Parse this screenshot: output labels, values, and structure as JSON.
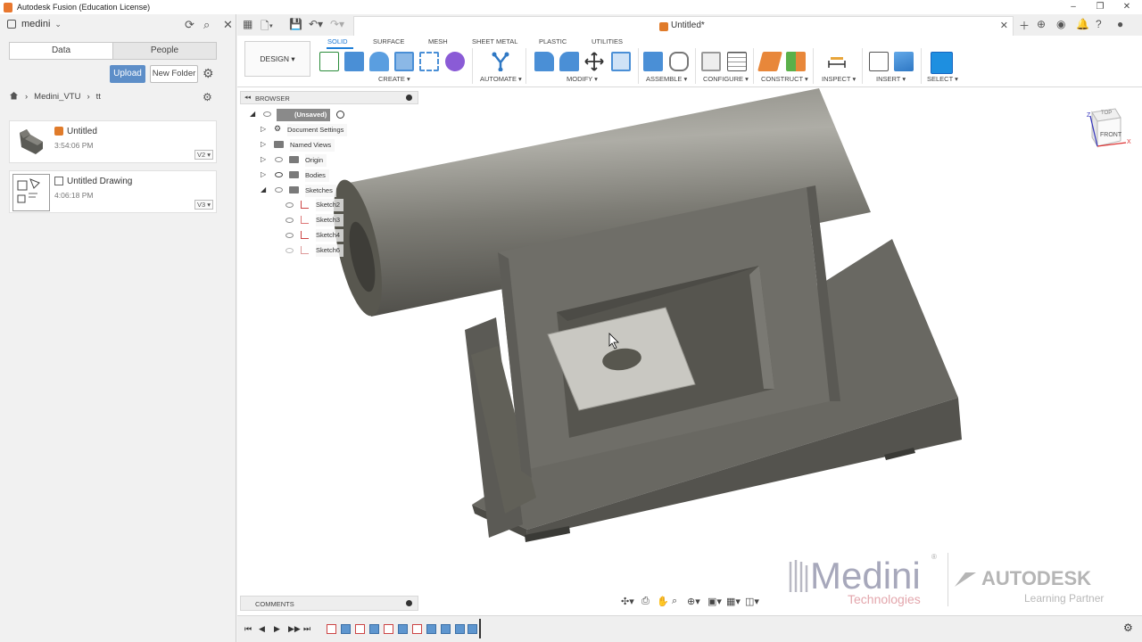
{
  "window": {
    "title": "Autodesk Fusion (Education License)",
    "controls": [
      "–",
      "❐",
      "✕"
    ]
  },
  "data_panel": {
    "hub_name": "medini",
    "tabs": [
      "Data",
      "People"
    ],
    "upload_label": "Upload",
    "new_folder_label": "New Folder",
    "breadcrumb": [
      "Medini_VTU",
      "tt"
    ],
    "files": [
      {
        "name": "Untitled",
        "time": "3:54:06 PM",
        "version": "V2 ▾"
      },
      {
        "name": "Untitled Drawing",
        "time": "4:06:18 PM",
        "version": "V3 ▾"
      }
    ]
  },
  "document": {
    "name": "Untitled*"
  },
  "ribbon": {
    "workspace": "DESIGN ▾",
    "tabs": [
      "SOLID",
      "SURFACE",
      "MESH",
      "SHEET METAL",
      "PLASTIC",
      "UTILITIES"
    ],
    "active_tab": "SOLID",
    "groups": [
      "CREATE ▾",
      "AUTOMATE ▾",
      "MODIFY ▾",
      "ASSEMBLE ▾",
      "CONFIGURE ▾",
      "CONSTRUCT ▾",
      "INSPECT ▾",
      "INSERT ▾",
      "SELECT ▾"
    ]
  },
  "browser": {
    "title": "BROWSER",
    "root": "(Unsaved)",
    "items": [
      "Document Settings",
      "Named Views",
      "Origin",
      "Bodies",
      "Sketches"
    ],
    "sketches": [
      "Sketch2",
      "Sketch3",
      "Sketch4",
      "Sketch6"
    ]
  },
  "comments": {
    "title": "COMMENTS"
  },
  "viewcube": {
    "top": "TOP",
    "front": "FRONT",
    "axis_x": "X",
    "axis_z": "Z"
  },
  "watermark": {
    "brand": "Medini",
    "sub": "Technologies",
    "partner": "AUTODESK",
    "partner_sub": "Learning Partner"
  },
  "colors": {
    "accent": "#1e7fd8",
    "upload": "#5d8ec8",
    "model": "#6f6e68",
    "doc_icon": "#e07b2a"
  }
}
